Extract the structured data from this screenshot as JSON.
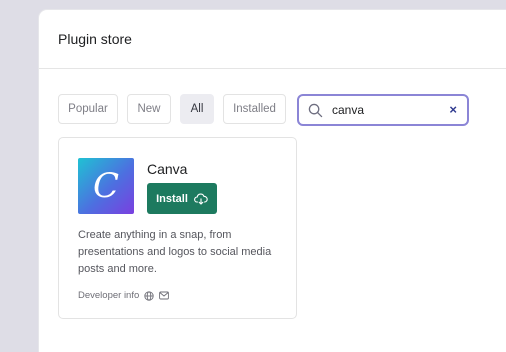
{
  "modal": {
    "title": "Plugin store"
  },
  "filters": [
    {
      "label": "Popular",
      "active": false
    },
    {
      "label": "New",
      "active": false
    },
    {
      "label": "All",
      "active": true
    },
    {
      "label": "Installed",
      "active": false
    }
  ],
  "search": {
    "value": "canva",
    "clear_label": "×"
  },
  "plugin": {
    "name": "Canva",
    "logo_letter": "C",
    "install_label": "Install",
    "description": "Create anything in a snap, from presentations and logos to social media posts and more.",
    "developer_label": "Developer info"
  },
  "colors": {
    "install_bg": "#1d7a5f",
    "search_border": "#8b85d6",
    "active_filter_bg": "#ececf1"
  }
}
